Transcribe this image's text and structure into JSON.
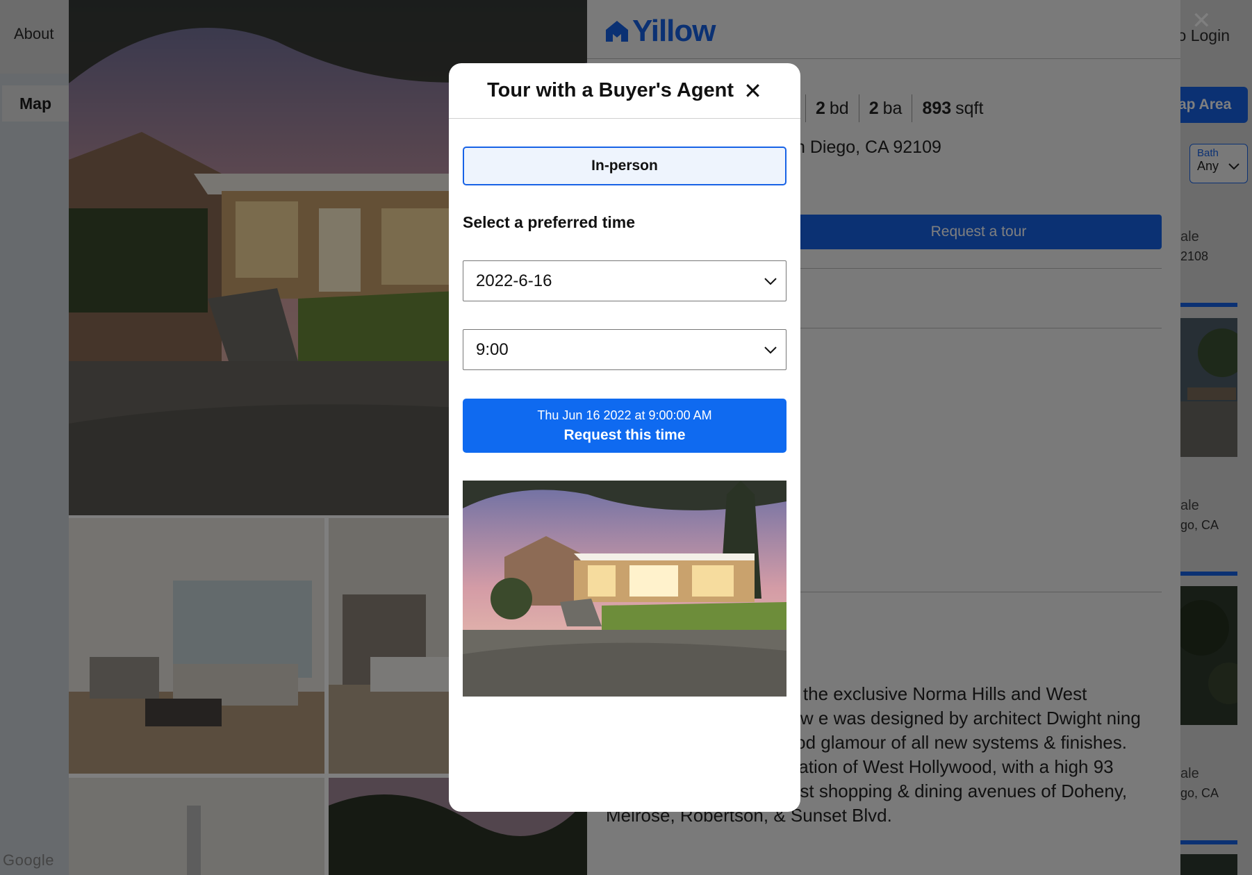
{
  "nav": {
    "about": "About",
    "login": "o Login"
  },
  "sidebar": {
    "map_tab": "Map"
  },
  "brand": {
    "logo_text": "Yillow",
    "accent": "#1762e6"
  },
  "listing": {
    "beds": "2",
    "beds_unit": "bd",
    "baths": "2",
    "baths_unit": "ba",
    "sqft": "893",
    "sqft_unit": "sqft",
    "address_partial": "n Diego, CA 92109",
    "request_tour_label": "Request a tour",
    "description": "ewel Box' in the heart of the exclusive Norma Hills and West Hollywood meet. The new e was designed by architect Dwight ning example of Old Hollywood glamour of all new systems & finishes. Located in the 'Flats' location of West Hollywood, with a high 93 Walk-Score, near the best shopping & dining avenues of Doheny, Melrose, Robertson, & Sunset Blvd."
  },
  "right_panel": {
    "map_area_label": "ap Area",
    "bath_filter_label": "Bath",
    "bath_filter_value": "Any",
    "card1_status": "ale",
    "card1_zip": "2108",
    "card2_status": "ale",
    "card2_city": "go, CA",
    "card3_status": "ale",
    "card3_city": "go, CA"
  },
  "map": {
    "attribution": "Google"
  },
  "modal": {
    "title": "Tour with a Buyer's Agent",
    "tour_type": "In-person",
    "preferred_time_label": "Select a preferred time",
    "date_value": "2022-6-16",
    "time_value": "9:00",
    "selected_datetime": "Thu Jun 16 2022 at 9:00:00 AM",
    "request_time_label": "Request this time"
  }
}
